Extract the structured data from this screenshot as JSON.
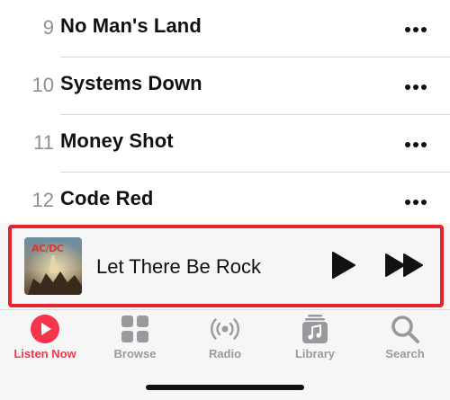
{
  "tracks": [
    {
      "number": "9",
      "title": "No Man's Land"
    },
    {
      "number": "10",
      "title": "Systems Down"
    },
    {
      "number": "11",
      "title": "Money Shot"
    },
    {
      "number": "12",
      "title": "Code Red"
    }
  ],
  "now_playing": {
    "title": "Let There Be Rock",
    "album_art_logo": "AC/DC"
  },
  "tabs": [
    {
      "label": "Listen Now",
      "icon": "listen-now-icon",
      "active": true
    },
    {
      "label": "Browse",
      "icon": "browse-grid-icon",
      "active": false
    },
    {
      "label": "Radio",
      "icon": "radio-broadcast-icon",
      "active": false
    },
    {
      "label": "Library",
      "icon": "library-music-icon",
      "active": false
    },
    {
      "label": "Search",
      "icon": "search-icon",
      "active": false
    }
  ],
  "colors": {
    "accent": "#f6344b",
    "highlight": "#e8232d",
    "inactive_tab": "#9a9a9e",
    "text": "#111111",
    "muted": "#8e8e93",
    "bar_background": "#f6f6f6"
  }
}
